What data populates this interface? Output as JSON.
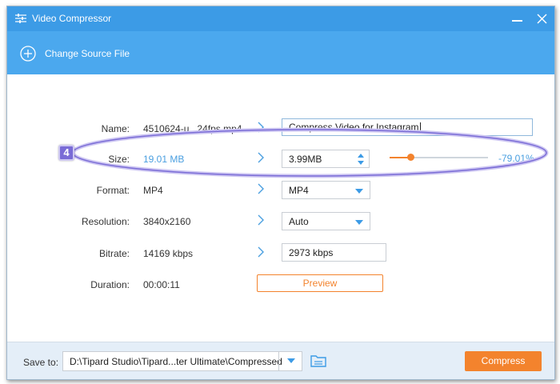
{
  "window": {
    "title": "Video Compressor",
    "app_icon": "sliders-icon",
    "buttons": [
      "minimize-icon",
      "close-icon"
    ]
  },
  "toolbar": {
    "change_source_label": "Change Source File",
    "change_source_icon": "plus-circle-icon"
  },
  "fields": {
    "name": {
      "label": "Name:",
      "source": "4510624-u...24fps.mp4",
      "output": "Compress Video for Instagram"
    },
    "size": {
      "label": "Size:",
      "source": "19.01 MB",
      "output": "3.99MB",
      "percent_text": "-79.01%",
      "compression_fraction": 0.21
    },
    "format": {
      "label": "Format:",
      "source": "MP4",
      "output": "MP4"
    },
    "resolution": {
      "label": "Resolution:",
      "source": "3840x2160",
      "output": "Auto"
    },
    "bitrate": {
      "label": "Bitrate:",
      "source": "14169 kbps",
      "output": "2973 kbps"
    },
    "duration": {
      "label": "Duration:",
      "source": "00:00:11"
    }
  },
  "preview_label": "Preview",
  "annotation": {
    "step_number": "4"
  },
  "footer": {
    "save_to_label": "Save to:",
    "save_path": "D:\\Tipard Studio\\Tipard...ter Ultimate\\Compressed",
    "compress_label": "Compress"
  },
  "colors": {
    "titlebar": "#3c9be6",
    "toolbar": "#4ba8ee",
    "accent_orange": "#f3832d",
    "value_blue": "#4a9fe0",
    "annotation_purple": "#7a6cd6",
    "footer_bg": "#e4eef8"
  }
}
